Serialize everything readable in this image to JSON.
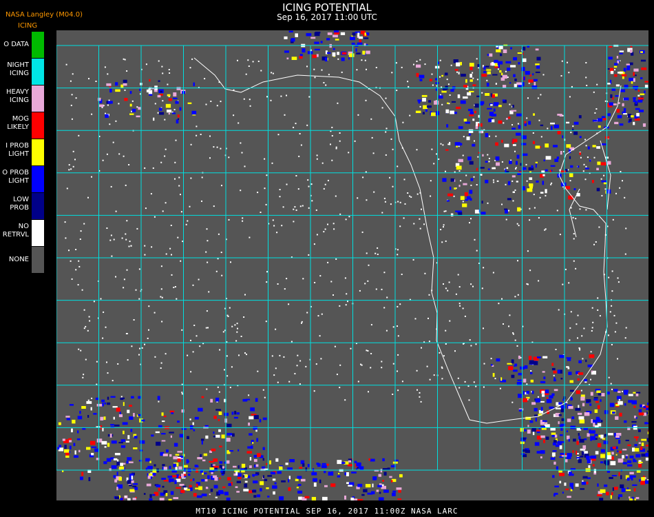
{
  "header": {
    "brand": "NASA Langley (M04.0)",
    "product": "ICING",
    "title": "ICING POTENTIAL",
    "timestamp": "Sep 16, 2017 11:00 UTC"
  },
  "legend": [
    {
      "label": "O DATA",
      "color": "#00bb00"
    },
    {
      "label": "NIGHT\nICING",
      "color": "#00e5e5"
    },
    {
      "label": "HEAVY\nICING",
      "color": "#e8a8d8"
    },
    {
      "label": "MOG\nLIKELY",
      "color": "#ff0000"
    },
    {
      "label": "I PROB\nLIGHT",
      "color": "#ffff00"
    },
    {
      "label": "O PROB\nLIGHT",
      "color": "#0000ff"
    },
    {
      "label": "LOW\nPROB",
      "color": "#000088"
    },
    {
      "label": "NO\nRETRVL",
      "color": "#ffffff"
    },
    {
      "label": "NONE",
      "color": "#555555"
    }
  ],
  "map": {
    "background_color": "#555555",
    "grid_color": "#00e0e0",
    "coastline_color": "#ffffff",
    "label_color": "#cc2222"
  },
  "footer": "MT10  ICING POTENTIAL   SEP 16, 2017 11:00Z   NASA LARC"
}
